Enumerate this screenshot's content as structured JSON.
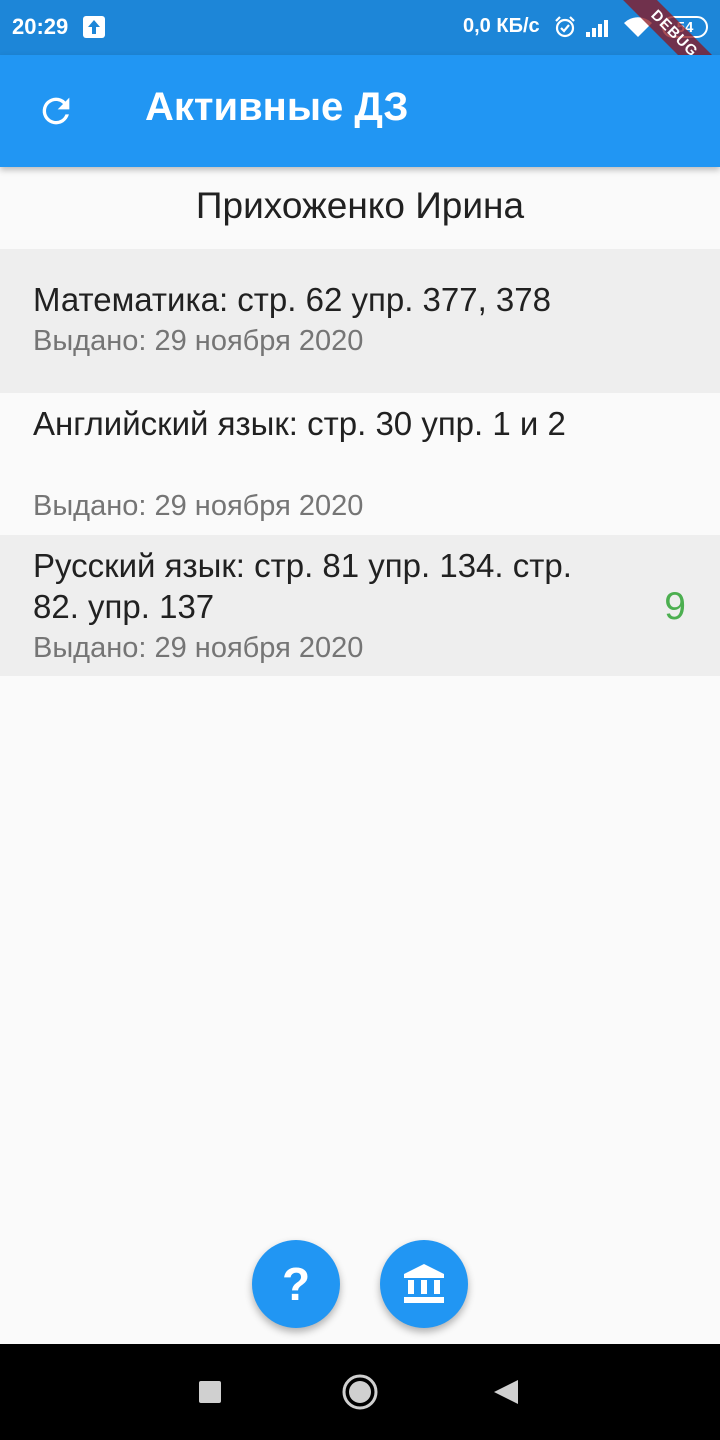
{
  "status_bar": {
    "time": "20:29",
    "speed": "0,0 КБ/с",
    "battery": "54",
    "debug_label": "DEBUG",
    "icons": [
      "upload-icon",
      "alarm-icon",
      "signal-icon",
      "wifi-icon",
      "battery-icon"
    ]
  },
  "app_bar": {
    "title": "Активные ДЗ",
    "refresh_icon": "refresh-icon"
  },
  "student": {
    "name": "Прихоженко Ирина"
  },
  "homework": [
    {
      "subject": "Математика: стр. 62 упр. 377, 378",
      "issued": "Выдано: 29 ноября 2020",
      "grade": ""
    },
    {
      "subject": "Английский язык: стр. 30 упр. 1 и 2",
      "issued": "Выдано: 29 ноября 2020",
      "grade": ""
    },
    {
      "subject": "Русский язык: стр. 81 упр. 134. стр. 82. упр. 137",
      "issued": "Выдано: 29 ноября 2020",
      "grade": "9"
    }
  ],
  "fabs": {
    "help_label": "?",
    "help_icon": "help-icon",
    "bank_icon": "institution-icon"
  },
  "colors": {
    "primary": "#2196f3",
    "status_bar": "#1d86d8",
    "grade": "#4caf50",
    "shaded_row": "#eeeeee"
  },
  "nav_bar": {
    "icons": [
      "recent-apps-icon",
      "home-icon",
      "back-icon"
    ]
  }
}
